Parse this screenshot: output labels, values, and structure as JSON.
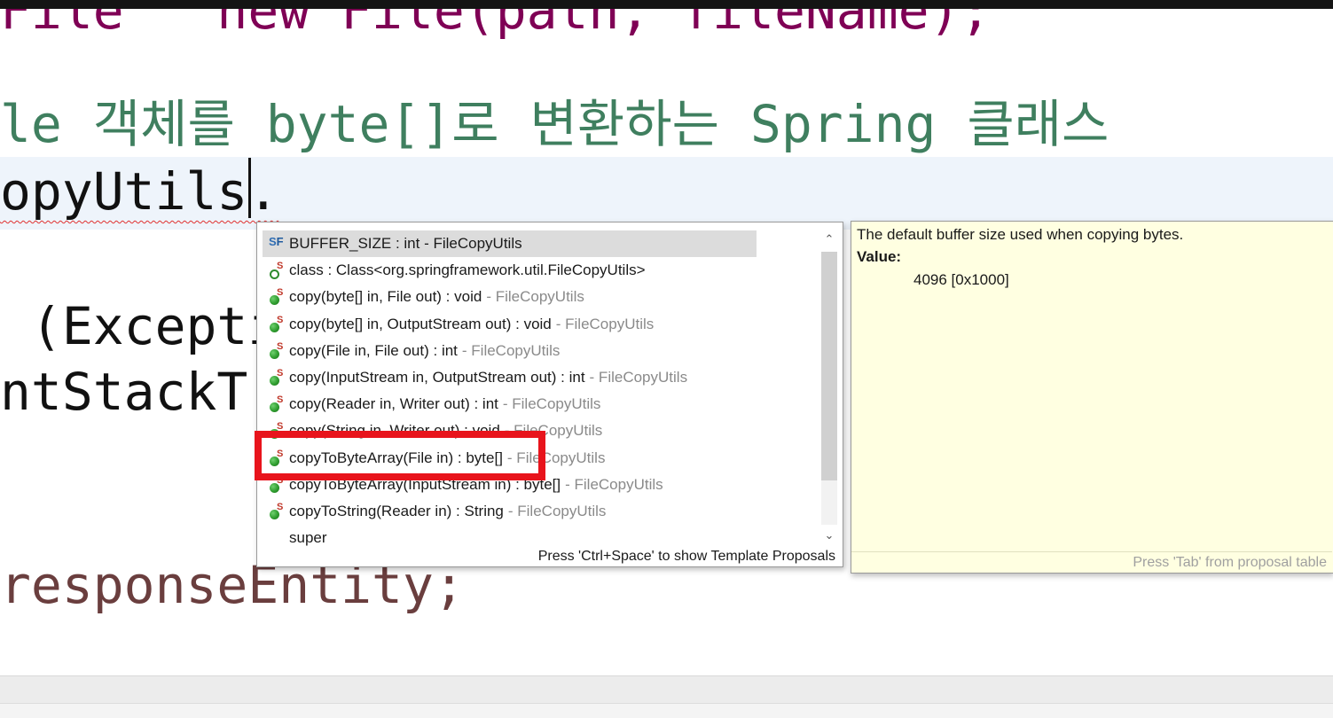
{
  "editor": {
    "line_partial_top": "File   new File(path, fileName);",
    "comment_line": "le 객체를 byte[]로 변환하는 Spring 클래스",
    "current_line": "opyUtils.",
    "exception_line": " (Exceptio",
    "stack_line": "ntStackTra",
    "return_line": "responseEntity;"
  },
  "assist": {
    "items": [
      {
        "label": "BUFFER_SIZE : int - FileCopyUtils",
        "owner": "",
        "icon": "static-final-field-icon",
        "selected": true
      },
      {
        "label": "class : Class<org.springframework.util.FileCopyUtils>",
        "owner": "",
        "icon": "class-literal-icon"
      },
      {
        "label": "copy(byte[] in, File out) : void",
        "owner": "- FileCopyUtils",
        "icon": "static-method-icon"
      },
      {
        "label": "copy(byte[] in, OutputStream out) : void",
        "owner": "- FileCopyUtils",
        "icon": "static-method-icon"
      },
      {
        "label": "copy(File in, File out) : int",
        "owner": "- FileCopyUtils",
        "icon": "static-method-icon"
      },
      {
        "label": "copy(InputStream in, OutputStream out) : int",
        "owner": "- FileCopyUtils",
        "icon": "static-method-icon"
      },
      {
        "label": "copy(Reader in, Writer out) : int",
        "owner": "- FileCopyUtils",
        "icon": "static-method-icon"
      },
      {
        "label": "copy(String in, Writer out) : void",
        "owner": "- FileCopyUtils",
        "icon": "static-method-icon"
      },
      {
        "label": "copyToByteArray(File in) : byte[]",
        "owner": "- FileCopyUtils",
        "icon": "static-method-icon"
      },
      {
        "label": "copyToByteArray(InputStream in) : byte[]",
        "owner": "- FileCopyUtils",
        "icon": "static-method-icon"
      },
      {
        "label": "copyToString(Reader in) : String",
        "owner": "- FileCopyUtils",
        "icon": "static-method-icon"
      },
      {
        "label": "super",
        "owner": "",
        "icon": "none"
      }
    ],
    "footer": "Press 'Ctrl+Space' to show Template Proposals",
    "scroll_up": "⌃",
    "scroll_down": "⌄"
  },
  "doc": {
    "description": "The default buffer size used when copying bytes.",
    "value_label": "Value:",
    "value": "4096 [0x1000]",
    "footer": "Press 'Tab' from proposal table"
  },
  "colors": {
    "comment": "#3f7f5f",
    "highlight_box": "#e8141c",
    "doc_background": "#ffffe1",
    "method_icon": "#2f9d2f"
  }
}
